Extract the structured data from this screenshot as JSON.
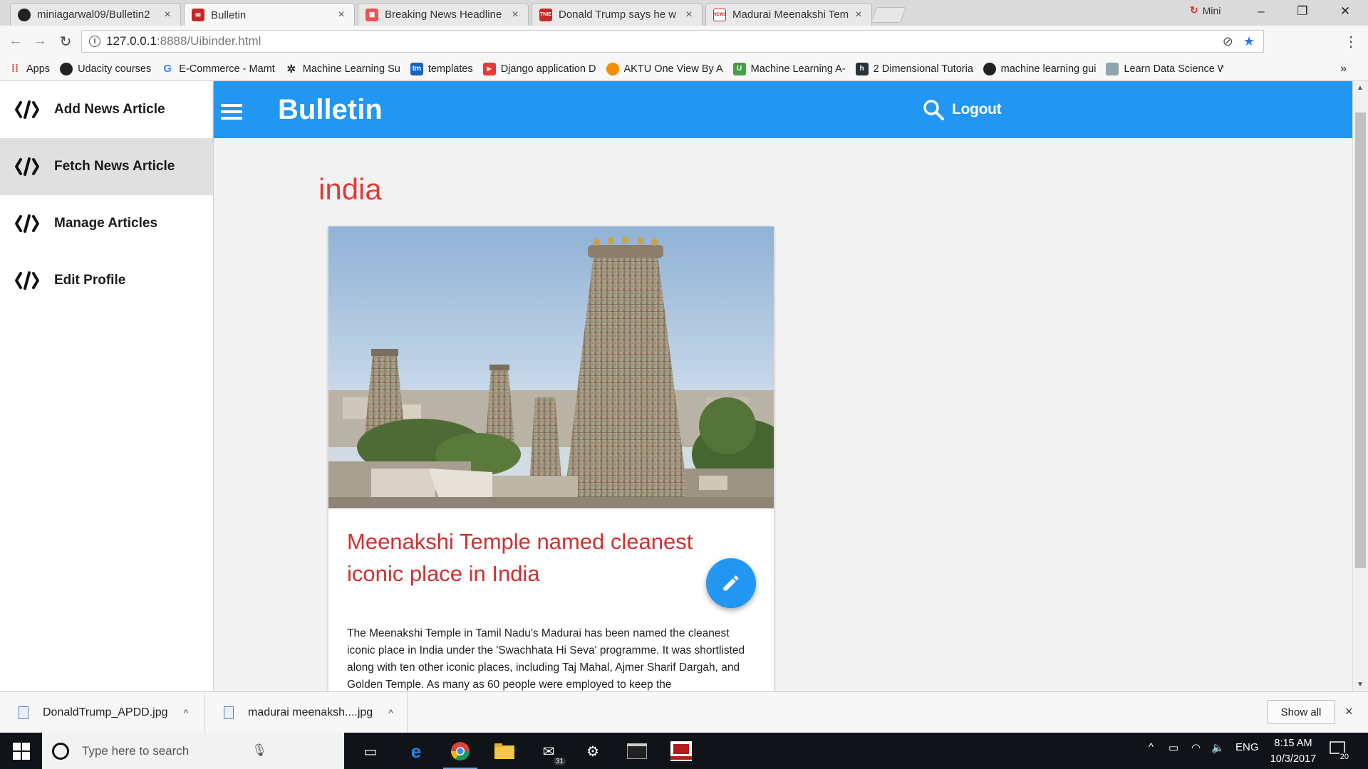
{
  "browser": {
    "tabs": [
      {
        "title": "miniagarwal09/Bulletin2",
        "icon": "github-icon",
        "active": false
      },
      {
        "title": "Bulletin",
        "icon": "bulletin-icon",
        "active": true
      },
      {
        "title": "Breaking News Headline",
        "icon": "news-grid-icon",
        "active": false
      },
      {
        "title": "Donald Trump says he w",
        "icon": "tnie-icon",
        "active": false
      },
      {
        "title": "Madurai Meenakshi Tem",
        "icon": "news-icon",
        "active": false
      }
    ],
    "tab_close": "×",
    "profile_name": "Mini",
    "address": {
      "host": "127.0.0.1",
      "path": ":8888/Uibinder.html"
    },
    "bookmarks": [
      {
        "label": "Apps",
        "icon": "apps-grid-icon"
      },
      {
        "label": "Udacity courses",
        "icon": "github-icon"
      },
      {
        "label": "E-Commerce - Mamt",
        "icon": "google-icon"
      },
      {
        "label": "Machine Learning Su",
        "icon": "gear-icon"
      },
      {
        "label": "templates",
        "icon": "tm-icon"
      },
      {
        "label": "Django application D",
        "icon": "youtube-icon"
      },
      {
        "label": "AKTU One View By A",
        "icon": "aktu-icon"
      },
      {
        "label": "Machine Learning A-",
        "icon": "udemy-icon"
      },
      {
        "label": "2 Dimensional Tutoria",
        "icon": "hackerearth-icon"
      },
      {
        "label": "machine learning gui",
        "icon": "github-icon"
      },
      {
        "label": "Learn Data Science W",
        "icon": "datascience-icon"
      }
    ],
    "bookmarks_more": "»"
  },
  "app": {
    "brand": "Bulletin",
    "logout": "Logout",
    "sidebar": [
      {
        "label": "Add News Article",
        "active": false
      },
      {
        "label": "Fetch News Article",
        "active": true
      },
      {
        "label": "Manage Articles",
        "active": false
      },
      {
        "label": "Edit Profile",
        "active": false
      }
    ],
    "category": "india",
    "article": {
      "title": "Meenakshi Temple named cleanest iconic place in India",
      "body": "The Meenakshi Temple in Tamil Nadu's Madurai has been named the cleanest iconic place in India under the 'Swachhata Hi Seva' programme. It was shortlisted along with ten other iconic places, including Taj Mahal, Ajmer Sharif Dargah, and Golden Temple. As many as 60 people were employed to keep the"
    },
    "colors": {
      "primary": "#2196f3",
      "accent_text": "#e53935",
      "title_text": "#d32f2f"
    }
  },
  "downloads": {
    "items": [
      {
        "name": "DonaldTrump_APDD.jpg"
      },
      {
        "name": "madurai meenaksh....jpg"
      }
    ],
    "show_all": "Show all",
    "close": "×"
  },
  "taskbar": {
    "search_placeholder": "Type here to search",
    "language": "ENG",
    "time": "8:15 AM",
    "date": "10/3/2017",
    "notification_count": "20",
    "mail_badge": "31"
  }
}
